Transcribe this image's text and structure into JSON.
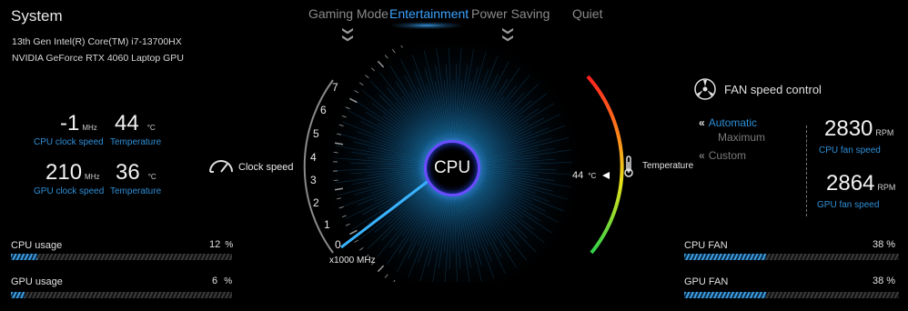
{
  "modes": {
    "tabs": [
      "Gaming Mode",
      "Entertainment",
      "Power Saving",
      "Quiet"
    ],
    "active": "Entertainment"
  },
  "system": {
    "title": "System",
    "cpu_model": "13th Gen Intel(R) Core(TM) i7-13700HX",
    "gpu_model": "NVIDIA GeForce RTX 4060 Laptop GPU"
  },
  "cpu_stats": {
    "clock_value": "-1",
    "clock_unit": "MHz",
    "clock_label": "CPU clock speed",
    "temp_value": "44",
    "temp_unit": "°C",
    "temp_label": "Temperature"
  },
  "gpu_stats": {
    "clock_value": "210",
    "clock_unit": "MHz",
    "clock_label": "GPU clock speed",
    "temp_value": "36",
    "temp_unit": "°C",
    "temp_label": "Temperature"
  },
  "usage": {
    "cpu_label": "CPU usage",
    "cpu_value": "12",
    "cpu_pct": 12,
    "gpu_label": "GPU usage",
    "gpu_value": "6",
    "gpu_pct": 6,
    "unit": "%"
  },
  "gauge": {
    "center_label": "CPU",
    "clock_speed_label": "Clock speed",
    "ticks": [
      "0",
      "1",
      "2",
      "3",
      "4",
      "5",
      "6",
      "7"
    ],
    "unit_label": "x1000 MHz",
    "temperature_label": "Temperature",
    "temperature_value": "44",
    "temperature_unit": "°C"
  },
  "fan": {
    "title": "FAN speed control",
    "options": [
      "Automatic",
      "Maximum",
      "Custom"
    ],
    "selected": "Automatic",
    "cpu_rpm": "2830",
    "gpu_rpm": "2864",
    "rpm_unit": "RPM",
    "cpu_fan_label": "CPU fan speed",
    "gpu_fan_label": "GPU fan speed",
    "cpu_fan_bar_label": "CPU FAN",
    "cpu_fan_pct_text": "38 %",
    "cpu_fan_pct": 38,
    "gpu_fan_bar_label": "GPU FAN",
    "gpu_fan_pct_text": "38 %",
    "gpu_fan_pct": 38
  },
  "colors": {
    "accent_blue": "#2e8fd6",
    "active_tab": "#3aa3ff",
    "ring": "#6a4cff"
  }
}
